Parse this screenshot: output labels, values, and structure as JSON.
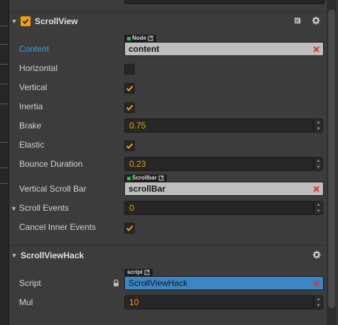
{
  "colors": {
    "accent": "#f39c12",
    "link": "#2fa3e6",
    "clear": "#e03030",
    "script_field": "#3b86c4"
  },
  "scroll_view": {
    "title": "ScrollView",
    "enabled": true,
    "header_icons": [
      "book-icon",
      "gear-icon"
    ],
    "content": {
      "label": "Content",
      "tag": "Node",
      "value": "content"
    },
    "horizontal": {
      "label": "Horizontal",
      "checked": false
    },
    "vertical": {
      "label": "Vertical",
      "checked": true
    },
    "inertia": {
      "label": "Inertia",
      "checked": true
    },
    "brake": {
      "label": "Brake",
      "value": "0.75"
    },
    "elastic": {
      "label": "Elastic",
      "checked": true
    },
    "bounce_duration": {
      "label": "Bounce Duration",
      "value": "0.23"
    },
    "vertical_scroll_bar": {
      "label": "Vertical Scroll Bar",
      "tag": "Scrollbar",
      "value": "scrollBar"
    },
    "scroll_events": {
      "label": "Scroll Events",
      "value": "0"
    },
    "cancel_inner_events": {
      "label": "Cancel Inner Events",
      "checked": true
    }
  },
  "scroll_view_hack": {
    "title": "ScrollViewHack",
    "header_icons": [
      "gear-icon"
    ],
    "script": {
      "label": "Script",
      "tag": "script",
      "value": "ScrollViewHack"
    },
    "mul": {
      "label": "Mul",
      "value": "10"
    }
  }
}
